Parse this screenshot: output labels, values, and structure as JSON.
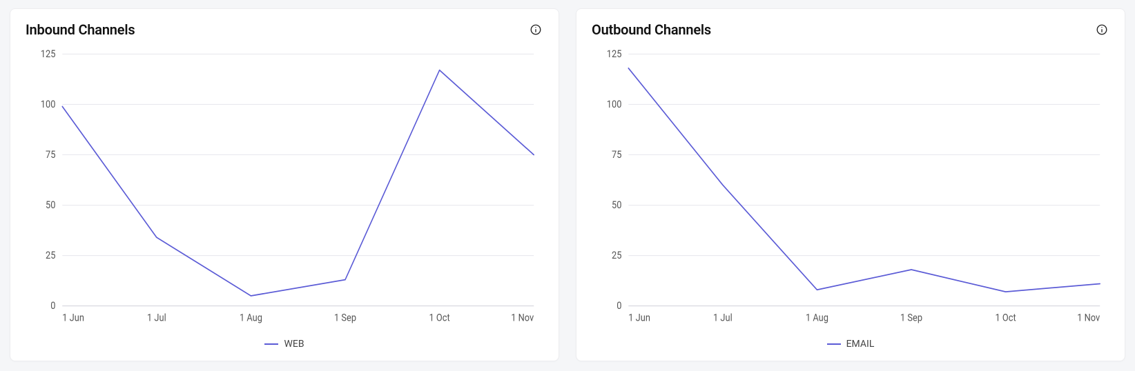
{
  "cards": [
    {
      "title": "Inbound Channels",
      "chart_key": "inbound"
    },
    {
      "title": "Outbound Channels",
      "chart_key": "outbound"
    }
  ],
  "chart_data": [
    {
      "id": "inbound",
      "type": "line",
      "title": "Inbound Channels",
      "xlabel": "",
      "ylabel": "",
      "x": [
        "1 Jun",
        "1 Jul",
        "1 Aug",
        "1 Sep",
        "1 Oct",
        "1 Nov"
      ],
      "y_ticks": [
        0,
        25,
        50,
        75,
        100,
        125
      ],
      "ylim": [
        0,
        125
      ],
      "series": [
        {
          "name": "WEB",
          "values": [
            99,
            34,
            5,
            13,
            117,
            75
          ]
        }
      ],
      "line_color": "#5b5bd6"
    },
    {
      "id": "outbound",
      "type": "line",
      "title": "Outbound Channels",
      "xlabel": "",
      "ylabel": "",
      "x": [
        "1 Jun",
        "1 Jul",
        "1 Aug",
        "1 Sep",
        "1 Oct",
        "1 Nov"
      ],
      "y_ticks": [
        0,
        25,
        50,
        75,
        100,
        125
      ],
      "ylim": [
        0,
        125
      ],
      "series": [
        {
          "name": "EMAIL",
          "values": [
            118,
            60,
            8,
            18,
            7,
            11
          ]
        }
      ],
      "line_color": "#5b5bd6"
    }
  ]
}
